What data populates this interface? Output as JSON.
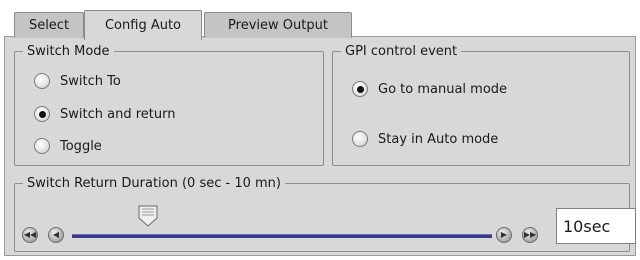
{
  "tabs": [
    {
      "label": "Select",
      "active": false
    },
    {
      "label": "Config Auto",
      "active": true
    },
    {
      "label": "Preview Output",
      "active": false
    }
  ],
  "switch_mode": {
    "legend": "Switch Mode",
    "options": [
      {
        "label": "Switch To",
        "selected": false
      },
      {
        "label": "Switch and return",
        "selected": true
      },
      {
        "label": "Toggle",
        "selected": false
      }
    ]
  },
  "gpi": {
    "legend": "GPI control event",
    "options": [
      {
        "label": "Go to manual mode",
        "selected": true
      },
      {
        "label": "Stay in Auto mode",
        "selected": false
      }
    ]
  },
  "duration": {
    "legend": "Switch Return Duration (0 sec - 10 mn)",
    "value": "10sec",
    "slider_fraction": 0.18
  },
  "colors": {
    "track": "#3a3a8c",
    "panel": "#d8d8d8"
  },
  "icons": [
    "rewind-fast-icon",
    "step-back-icon",
    "step-forward-icon",
    "forward-fast-icon",
    "slider-thumb-icon"
  ]
}
